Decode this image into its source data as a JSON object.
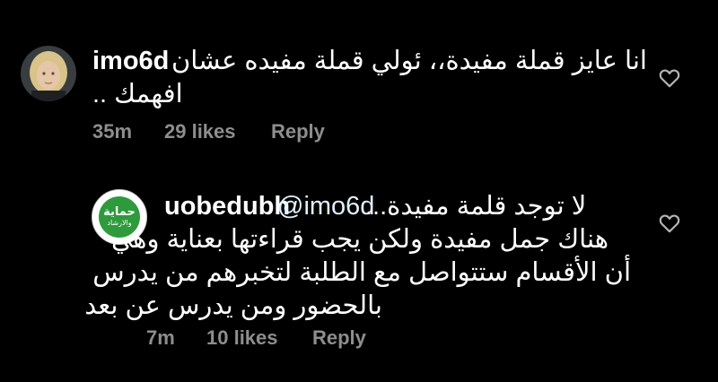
{
  "comments": [
    {
      "username": "imo6d",
      "line1": "انا عايز قملة مفيدة،، ئولي قملة مفيده عشان",
      "line2": "افهمك ..",
      "time": "35m",
      "likes": "29 likes",
      "reply": "Reply",
      "avatar_icon": "user-photo-avatar",
      "like_icon": "heart-outline-icon"
    },
    {
      "username": "uobedubh",
      "mention": "@imo6d",
      "line1": "لا توجد قلمة مفيدة...",
      "line2": "هناك جمل مفيدة ولكن يجب قراءتها بعناية وهي",
      "line3": "أن الأقسام ستتواصل مع الطلبة لتخبرهم من يدرس",
      "line4": "بالحضور ومن يدرس عن بعد",
      "avatar_text": "حماية",
      "avatar_subtext": "والارشاد",
      "avatar_color": "#2e9a3c",
      "time": "7m",
      "likes": "10 likes",
      "reply": "Reply",
      "like_icon": "heart-outline-icon"
    }
  ]
}
